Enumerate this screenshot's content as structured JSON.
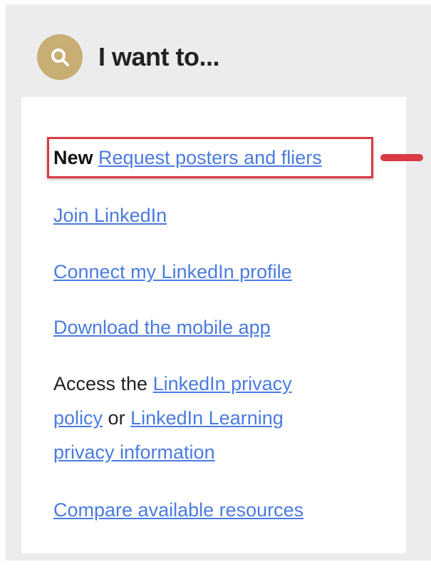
{
  "header": {
    "title": "I want to...",
    "icon": "search-icon",
    "icon_bg_color": "#c8ad74"
  },
  "links": {
    "new_tag": "New",
    "request_posters": "Request posters and fliers",
    "join_linkedin": "Join LinkedIn",
    "connect_profile": "Connect my LinkedIn profile",
    "download_app": "Download the mobile app",
    "access_prefix": "Access the",
    "privacy_policy_line1": "LinkedIn privacy",
    "privacy_policy_line2": "policy",
    "or_text": "or",
    "learning_privacy_line1": "LinkedIn Learning",
    "learning_privacy_line2": "privacy information",
    "compare_resources": "Compare available resources"
  },
  "colors": {
    "link": "#4a7be0",
    "highlight": "#d93a43",
    "panel_bg": "#ececec"
  }
}
